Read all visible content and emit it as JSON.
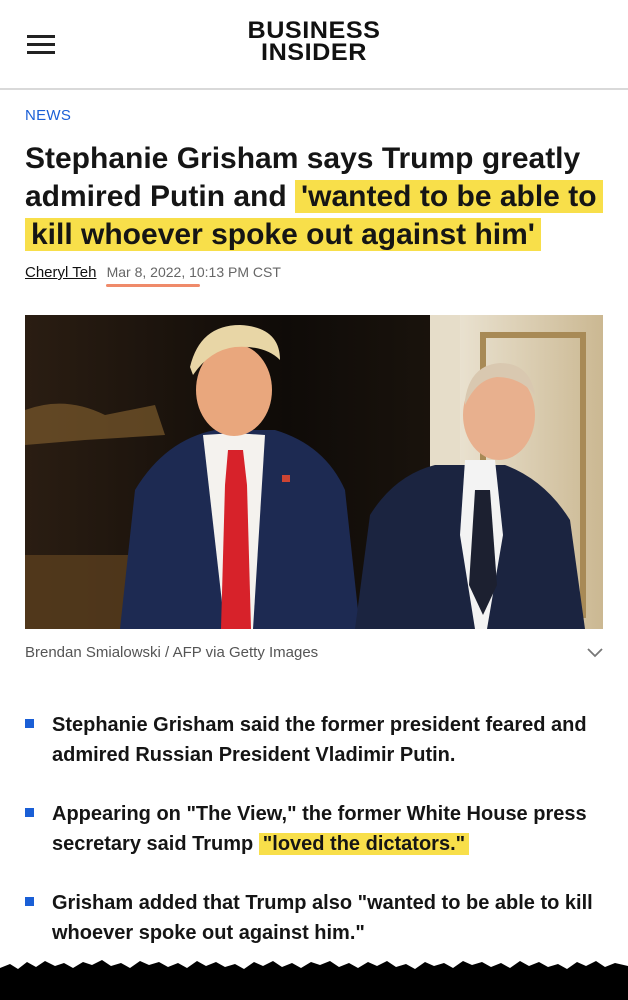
{
  "header": {
    "logo_line1": "BUSINESS",
    "logo_line2": "INSIDER",
    "menu_icon": "hamburger-menu-icon"
  },
  "article": {
    "kicker": "NEWS",
    "headline_plain": "Stephanie Grisham says Trump greatly admired Putin and ",
    "headline_highlight": "'wanted to be able to kill whoever spoke out against him'",
    "author": "Cheryl Teh",
    "date": "Mar 8, 2022, 10:13 PM CST",
    "photo_caption": "Brendan Smialowski / AFP via Getty Images",
    "bullets": [
      {
        "text": "Stephanie Grisham said the former president feared and admired Russian President Vladimir Putin."
      },
      {
        "text_plain": "Appearing on \"The View,\" the former White House press secretary said Trump ",
        "text_highlight": "\"loved the dictators.\""
      },
      {
        "text": "Grisham added that Trump also \"wanted to be able to kill whoever spoke out against him.\""
      }
    ]
  },
  "colors": {
    "highlight": "#f8df4a",
    "accent_blue": "#1a5fd6",
    "date_underline": "#ef8a6a"
  }
}
